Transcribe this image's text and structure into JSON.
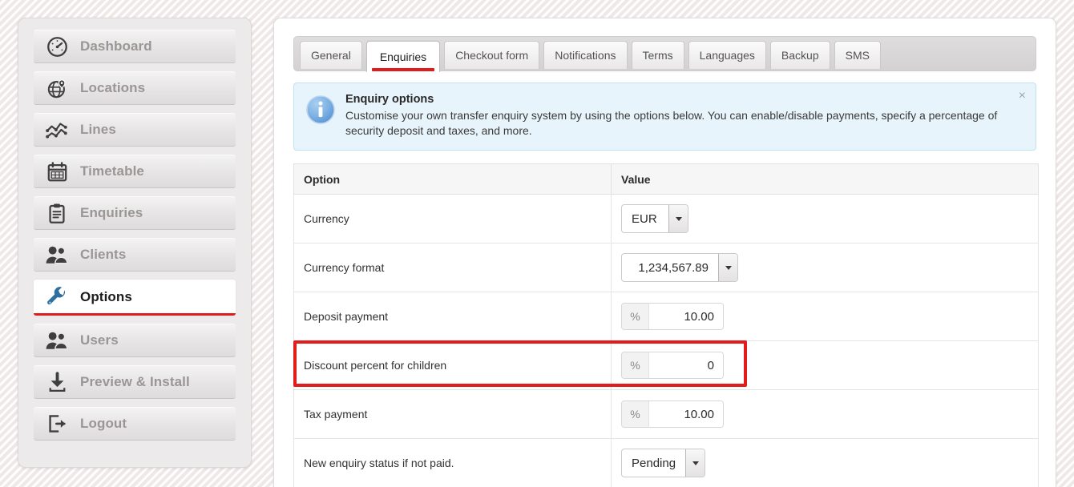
{
  "sidebar": {
    "items": [
      {
        "label": "Dashboard",
        "icon": "gauge-icon",
        "active": false
      },
      {
        "label": "Locations",
        "icon": "globe-pin-icon",
        "active": false
      },
      {
        "label": "Lines",
        "icon": "line-chart-icon",
        "active": false
      },
      {
        "label": "Timetable",
        "icon": "calendar-icon",
        "active": false
      },
      {
        "label": "Enquiries",
        "icon": "clipboard-icon",
        "active": false
      },
      {
        "label": "Clients",
        "icon": "users-icon",
        "active": false
      },
      {
        "label": "Options",
        "icon": "wrench-icon",
        "active": true
      },
      {
        "label": "Users",
        "icon": "users-icon",
        "active": false
      },
      {
        "label": "Preview & Install",
        "icon": "download-icon",
        "active": false
      },
      {
        "label": "Logout",
        "icon": "logout-icon",
        "active": false
      }
    ]
  },
  "tabs": [
    {
      "label": "General",
      "active": false
    },
    {
      "label": "Enquiries",
      "active": true
    },
    {
      "label": "Checkout form",
      "active": false
    },
    {
      "label": "Notifications",
      "active": false
    },
    {
      "label": "Terms",
      "active": false
    },
    {
      "label": "Languages",
      "active": false
    },
    {
      "label": "Backup",
      "active": false
    },
    {
      "label": "SMS",
      "active": false
    }
  ],
  "alert": {
    "icon": "info-icon",
    "title": "Enquiry options",
    "text": "Customise your own transfer enquiry system by using the options below. You can enable/disable payments, specify a percentage of security deposit and taxes, and more.",
    "close_label": "×"
  },
  "table": {
    "headers": {
      "option": "Option",
      "value": "Value"
    },
    "rows": [
      {
        "option": "Currency",
        "widget": "select",
        "value": "EUR"
      },
      {
        "option": "Currency format",
        "widget": "select",
        "value": "1,234,567.89"
      },
      {
        "option": "Deposit payment",
        "widget": "percent",
        "addon": "%",
        "value": "10.00"
      },
      {
        "option": "Discount percent for children",
        "widget": "percent",
        "addon": "%",
        "value": "0",
        "highlighted": true
      },
      {
        "option": "Tax payment",
        "widget": "percent",
        "addon": "%",
        "value": "10.00"
      },
      {
        "option": "New enquiry status if not paid.",
        "widget": "select",
        "value": "Pending"
      }
    ]
  },
  "colors": {
    "accent_red": "#e01b1b",
    "alert_bg": "#e8f4fb",
    "alert_border": "#c4e0ef",
    "info_blue": "#6ea8e0",
    "wrench_blue": "#2f6f9f",
    "icon_dark": "#3f3f3f"
  }
}
